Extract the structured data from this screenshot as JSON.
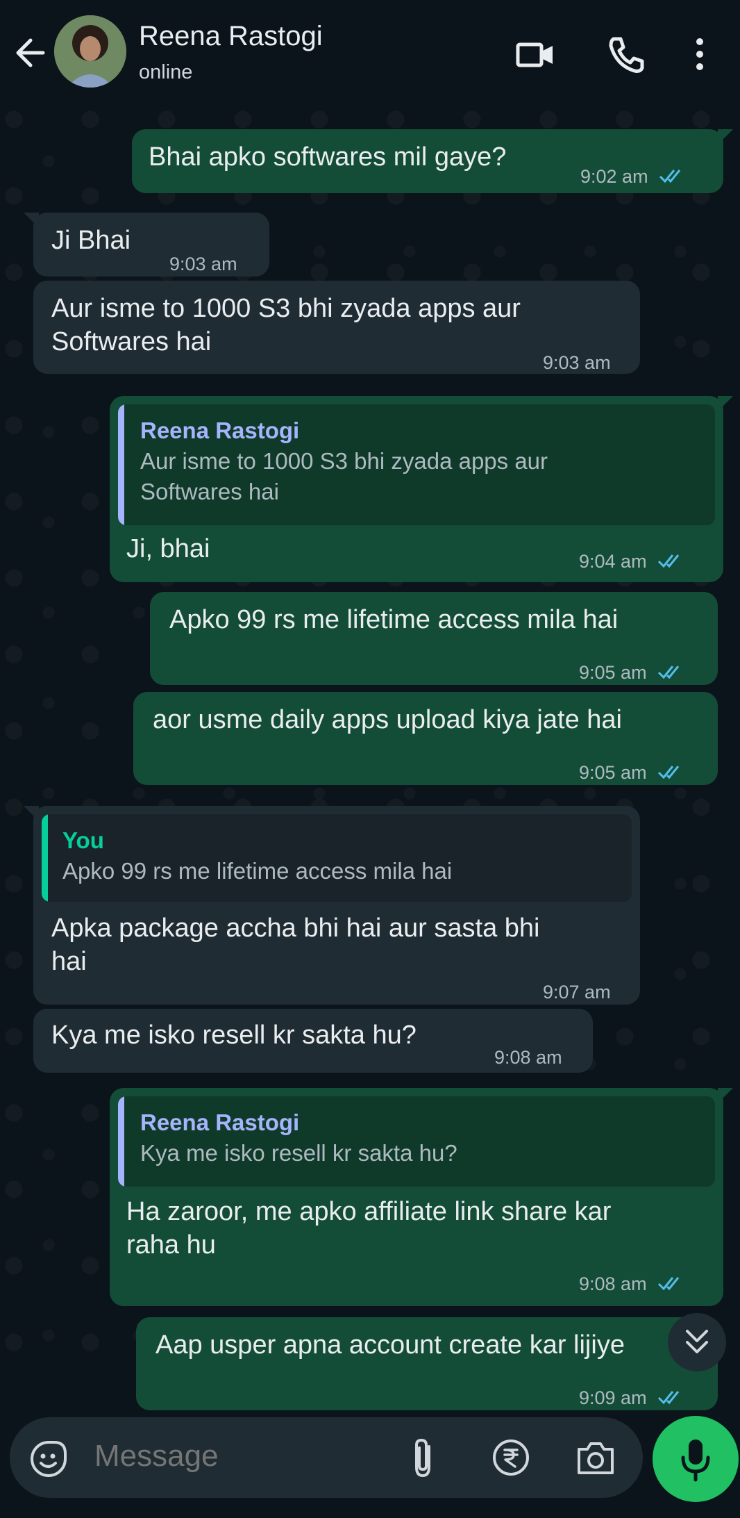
{
  "header": {
    "contact_name": "Reena Rastogi",
    "status": "online",
    "icons": [
      "back-arrow-icon",
      "video-call-icon",
      "phone-icon",
      "more-vertical-icon"
    ]
  },
  "messages": [
    {
      "dir": "out",
      "text": "Bhai apko softwares mil gaye?",
      "time": "9:02 am",
      "read": true
    },
    {
      "dir": "in",
      "text": "Ji Bhai",
      "time": "9:03 am"
    },
    {
      "dir": "in",
      "text": "Aur isme to 1000 S3 bhi zyada apps aur\nSoftwares hai",
      "time": "9:03 am"
    },
    {
      "dir": "out",
      "quote": {
        "name": "Reena Rastogi",
        "text": "Aur isme to 1000 S3 bhi zyada apps aur\nSoftwares hai"
      },
      "text": "Ji, bhai",
      "time": "9:04 am",
      "read": true
    },
    {
      "dir": "out",
      "text": "Apko 99 rs me lifetime access mila hai",
      "time": "9:05 am",
      "read": true
    },
    {
      "dir": "out",
      "text": "aor usme daily apps upload kiya jate hai",
      "time": "9:05 am",
      "read": true
    },
    {
      "dir": "in",
      "quote": {
        "name": "You",
        "text": "Apko 99 rs me lifetime access mila hai"
      },
      "text": "Apka package accha bhi hai aur sasta bhi\nhai",
      "time": "9:07 am"
    },
    {
      "dir": "in",
      "text": "Kya me isko resell kr sakta hu?",
      "time": "9:08 am"
    },
    {
      "dir": "out",
      "quote": {
        "name": "Reena Rastogi",
        "text": "Kya me isko resell kr sakta hu?"
      },
      "text": "Ha zaroor, me apko affiliate link share kar\nraha hu",
      "time": "9:08 am",
      "read": true
    },
    {
      "dir": "out",
      "text": "Aap usper apna account create kar lijiye",
      "time": "9:09 am",
      "read": true
    }
  ],
  "composer": {
    "placeholder": "Message",
    "icons": [
      "emoji-sticker-icon",
      "attach-icon",
      "rupee-payment-icon",
      "camera-icon",
      "mic-icon"
    ]
  },
  "colors": {
    "background": "#0b141a",
    "outgoing_bubble": "#144d37",
    "incoming_bubble": "#202c33",
    "read_ticks": "#53bdeb",
    "accent_green": "#21c063",
    "quote_name_contact": "#a5b4fc",
    "quote_name_you": "#06cf9c"
  }
}
